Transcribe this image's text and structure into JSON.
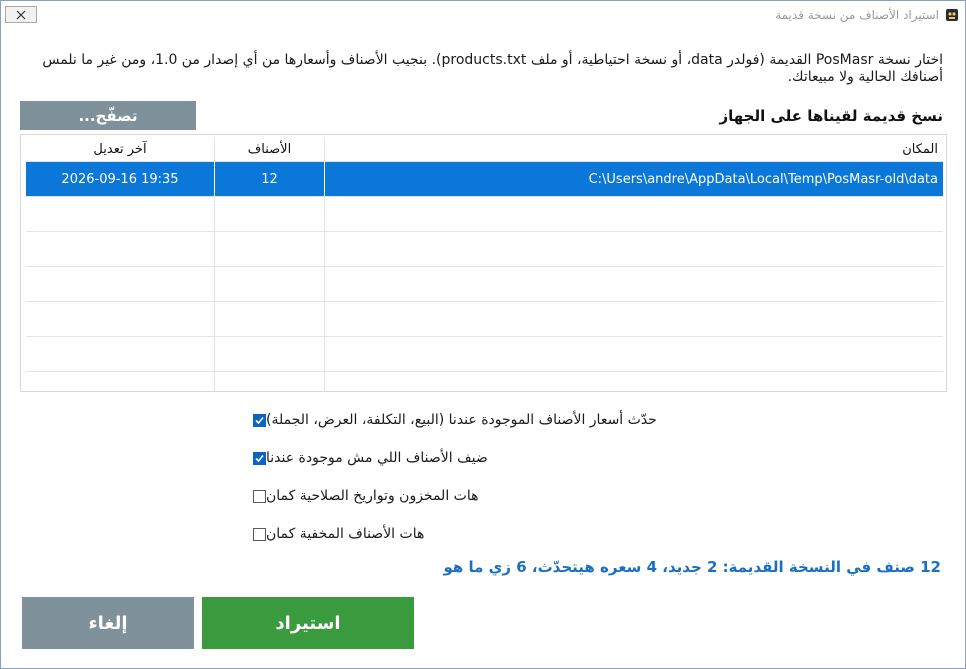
{
  "window": {
    "title": "استيراد الأصناف من نسخة قديمة",
    "app_icon": "app-logo-icon",
    "close_icon": "close-icon"
  },
  "description": "اختار نسخة PosMasr القديمة (فولدر data، أو نسخة احتياطية، أو ملف products.txt). بنجيب الأصناف وأسعارها من أي إصدار من 1.0، ومن غير ما نلمس أصنافك الحالية ولا مبيعاتك.",
  "section_title": "نسخ قديمة لقيناها على الجهاز",
  "browse_label": "تصفّح...",
  "table": {
    "headers": {
      "path": "المكان",
      "count": "الأصناف",
      "modified": "آخر تعديل"
    },
    "rows": [
      {
        "path": "C:\\Users\\andre\\AppData\\Local\\Temp\\PosMasr-old\\data",
        "count": "12",
        "modified": "2026-09-16 19:35",
        "selected": true
      }
    ]
  },
  "options": [
    {
      "label": "حدّث أسعار الأصناف الموجودة عندنا (البيع، التكلفة، العرض، الجملة)",
      "checked": true
    },
    {
      "label": "ضيف الأصناف اللي مش موجودة عندنا",
      "checked": true
    },
    {
      "label": "هات المخزون وتواريخ الصلاحية كمان",
      "checked": false
    },
    {
      "label": "هات الأصناف المخفية كمان",
      "checked": false
    }
  ],
  "summary": "12 صنف في النسخة القديمة: 2 جديد، 4 سعره هيتحدّث، 6 زي ما هو",
  "buttons": {
    "import": "استيراد",
    "cancel": "إلغاء"
  },
  "colors": {
    "selected_row": "#0b77d8",
    "import_button": "#3a9a3e",
    "secondary_button": "#7f929c",
    "summary_text": "#1a6fc2",
    "checkbox_on": "#0b63c4"
  }
}
